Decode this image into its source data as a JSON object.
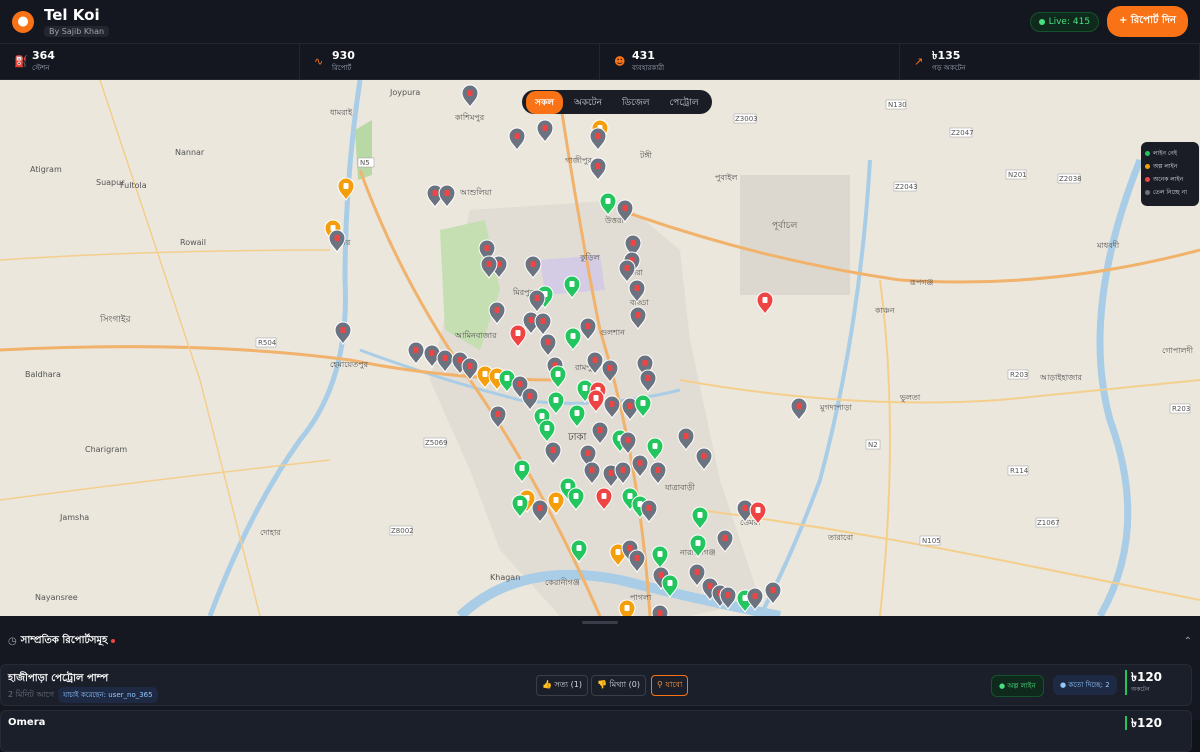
{
  "app": {
    "title": "Tel Koi",
    "byline": "By Sajib Khan",
    "live": "Live: 415",
    "report_button": "+ রিপোর্ট দিন"
  },
  "stats": [
    {
      "icon": "fuel-pump-icon",
      "value": "364",
      "label": "স্টেশন"
    },
    {
      "icon": "activity-icon",
      "value": "930",
      "label": "রিপোর্ট"
    },
    {
      "icon": "users-icon",
      "value": "431",
      "label": "ব্যবহারকারী"
    },
    {
      "icon": "trend-up-icon",
      "value": "৳135",
      "label": "গড় অকটেন"
    }
  ],
  "filters": [
    {
      "label": "সকল",
      "active": true
    },
    {
      "label": "অকটেন",
      "active": false
    },
    {
      "label": "ডিজেল",
      "active": false
    },
    {
      "label": "পেট্রোল",
      "active": false
    }
  ],
  "legend": [
    {
      "label": "লাইন নেই",
      "color": "#22c55e"
    },
    {
      "label": "অল্প লাইন",
      "color": "#f59e0b"
    },
    {
      "label": "অনেক লাইন",
      "color": "#ef4444"
    },
    {
      "label": "তেল নিচ্ছে না",
      "color": "#6b7280"
    }
  ],
  "map_labels": {
    "gazipur": "গাজীপুর",
    "dhaka": "ঢাকা",
    "singair": "সিংগাইর",
    "purbachal": "পূর্বাচল",
    "narayanganj": "নারায়ণগঞ্জ",
    "savar": "সাভার",
    "kashimpur": "কাশিমপুর",
    "tongi": "টঙ্গী",
    "mirpur": "মিরপুর",
    "uttara": "উত্তরা",
    "aminbazar": "আমিনবাজার",
    "keraniganj": "কেরানীগঞ্জ",
    "rupganj": "রূপগঞ্জ",
    "araihazar": "আড়াইহাজার",
    "madhabdi": "মাধবদী",
    "kanchan": "কাঞ্চন",
    "tarabo": "তারাবো",
    "gopaldi": "গোপালদী",
    "dohar": "দোহার",
    "ashulia": "আশুলিয়া",
    "joypura": "Joypura",
    "atigram": "Atigram",
    "suapur": "Suapur",
    "fultola": "Fultola",
    "rowail": "Rowail",
    "baldhara": "Baldhara",
    "charigram": "Charigram",
    "jamsha": "Jamsha",
    "nayansree": "Nayansree",
    "khagan": "Khagan",
    "nannar": "Nannar",
    "dhamrai": "ধামরাই",
    "pubail": "পুবাইল",
    "demra": "ডেমরা",
    "jatrabari": "যাত্রাবাড়ী",
    "hemayetpur": "হেমায়েতপুর",
    "badda": "বাড্ডা",
    "gulshan": "গুলশান",
    "basundhara": "বসুন্ধরা",
    "pagla": "পাগলা",
    "kuril": "কুড়িল",
    "rampura": "রামপুরা",
    "bhulta": "ভুলতা",
    "mugdapara": "মুগদাপাড়া"
  },
  "roads": [
    "N5",
    "R504",
    "Z5069",
    "Z8002",
    "N130",
    "Z3003",
    "Z2047",
    "Z2043",
    "N201",
    "Z2038",
    "R203",
    "R114",
    "Z1067",
    "N105",
    "N2",
    "R203"
  ],
  "recent": {
    "title": "সাম্প্রতিক রিপোর্টসমূহ",
    "items": [
      {
        "name": "হাজীপাড়া পেট্রোল পাম্প",
        "time": "2 মিনিট আগে",
        "user": "যাচাই করেছেন: user_no_365",
        "vote_true": "সত্য (1)",
        "vote_false": "মিথ্যা (0)",
        "go": "যাবো",
        "status": "অল্প লাইন",
        "wait": "কতো দিচ্ছে: 2",
        "price": "৳120",
        "price_label": "অকটেন"
      },
      {
        "name": "Omera",
        "price": "৳120"
      }
    ]
  }
}
